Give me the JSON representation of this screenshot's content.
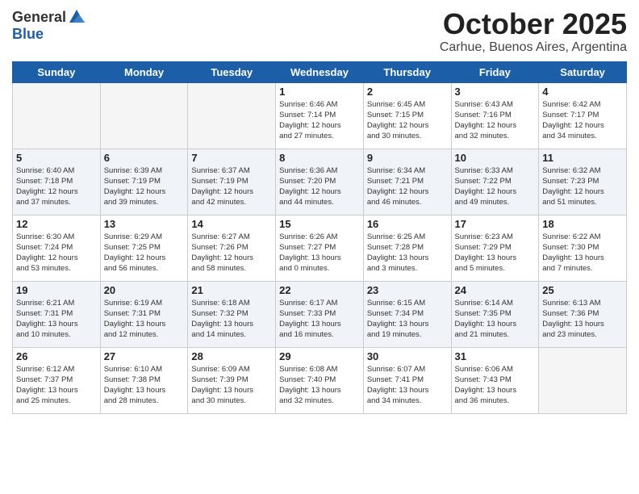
{
  "logo": {
    "general": "General",
    "blue": "Blue"
  },
  "title": "October 2025",
  "location": "Carhue, Buenos Aires, Argentina",
  "weekdays": [
    "Sunday",
    "Monday",
    "Tuesday",
    "Wednesday",
    "Thursday",
    "Friday",
    "Saturday"
  ],
  "weeks": [
    [
      {
        "day": "",
        "info": ""
      },
      {
        "day": "",
        "info": ""
      },
      {
        "day": "",
        "info": ""
      },
      {
        "day": "1",
        "info": "Sunrise: 6:46 AM\nSunset: 7:14 PM\nDaylight: 12 hours\nand 27 minutes."
      },
      {
        "day": "2",
        "info": "Sunrise: 6:45 AM\nSunset: 7:15 PM\nDaylight: 12 hours\nand 30 minutes."
      },
      {
        "day": "3",
        "info": "Sunrise: 6:43 AM\nSunset: 7:16 PM\nDaylight: 12 hours\nand 32 minutes."
      },
      {
        "day": "4",
        "info": "Sunrise: 6:42 AM\nSunset: 7:17 PM\nDaylight: 12 hours\nand 34 minutes."
      }
    ],
    [
      {
        "day": "5",
        "info": "Sunrise: 6:40 AM\nSunset: 7:18 PM\nDaylight: 12 hours\nand 37 minutes."
      },
      {
        "day": "6",
        "info": "Sunrise: 6:39 AM\nSunset: 7:19 PM\nDaylight: 12 hours\nand 39 minutes."
      },
      {
        "day": "7",
        "info": "Sunrise: 6:37 AM\nSunset: 7:19 PM\nDaylight: 12 hours\nand 42 minutes."
      },
      {
        "day": "8",
        "info": "Sunrise: 6:36 AM\nSunset: 7:20 PM\nDaylight: 12 hours\nand 44 minutes."
      },
      {
        "day": "9",
        "info": "Sunrise: 6:34 AM\nSunset: 7:21 PM\nDaylight: 12 hours\nand 46 minutes."
      },
      {
        "day": "10",
        "info": "Sunrise: 6:33 AM\nSunset: 7:22 PM\nDaylight: 12 hours\nand 49 minutes."
      },
      {
        "day": "11",
        "info": "Sunrise: 6:32 AM\nSunset: 7:23 PM\nDaylight: 12 hours\nand 51 minutes."
      }
    ],
    [
      {
        "day": "12",
        "info": "Sunrise: 6:30 AM\nSunset: 7:24 PM\nDaylight: 12 hours\nand 53 minutes."
      },
      {
        "day": "13",
        "info": "Sunrise: 6:29 AM\nSunset: 7:25 PM\nDaylight: 12 hours\nand 56 minutes."
      },
      {
        "day": "14",
        "info": "Sunrise: 6:27 AM\nSunset: 7:26 PM\nDaylight: 12 hours\nand 58 minutes."
      },
      {
        "day": "15",
        "info": "Sunrise: 6:26 AM\nSunset: 7:27 PM\nDaylight: 13 hours\nand 0 minutes."
      },
      {
        "day": "16",
        "info": "Sunrise: 6:25 AM\nSunset: 7:28 PM\nDaylight: 13 hours\nand 3 minutes."
      },
      {
        "day": "17",
        "info": "Sunrise: 6:23 AM\nSunset: 7:29 PM\nDaylight: 13 hours\nand 5 minutes."
      },
      {
        "day": "18",
        "info": "Sunrise: 6:22 AM\nSunset: 7:30 PM\nDaylight: 13 hours\nand 7 minutes."
      }
    ],
    [
      {
        "day": "19",
        "info": "Sunrise: 6:21 AM\nSunset: 7:31 PM\nDaylight: 13 hours\nand 10 minutes."
      },
      {
        "day": "20",
        "info": "Sunrise: 6:19 AM\nSunset: 7:31 PM\nDaylight: 13 hours\nand 12 minutes."
      },
      {
        "day": "21",
        "info": "Sunrise: 6:18 AM\nSunset: 7:32 PM\nDaylight: 13 hours\nand 14 minutes."
      },
      {
        "day": "22",
        "info": "Sunrise: 6:17 AM\nSunset: 7:33 PM\nDaylight: 13 hours\nand 16 minutes."
      },
      {
        "day": "23",
        "info": "Sunrise: 6:15 AM\nSunset: 7:34 PM\nDaylight: 13 hours\nand 19 minutes."
      },
      {
        "day": "24",
        "info": "Sunrise: 6:14 AM\nSunset: 7:35 PM\nDaylight: 13 hours\nand 21 minutes."
      },
      {
        "day": "25",
        "info": "Sunrise: 6:13 AM\nSunset: 7:36 PM\nDaylight: 13 hours\nand 23 minutes."
      }
    ],
    [
      {
        "day": "26",
        "info": "Sunrise: 6:12 AM\nSunset: 7:37 PM\nDaylight: 13 hours\nand 25 minutes."
      },
      {
        "day": "27",
        "info": "Sunrise: 6:10 AM\nSunset: 7:38 PM\nDaylight: 13 hours\nand 28 minutes."
      },
      {
        "day": "28",
        "info": "Sunrise: 6:09 AM\nSunset: 7:39 PM\nDaylight: 13 hours\nand 30 minutes."
      },
      {
        "day": "29",
        "info": "Sunrise: 6:08 AM\nSunset: 7:40 PM\nDaylight: 13 hours\nand 32 minutes."
      },
      {
        "day": "30",
        "info": "Sunrise: 6:07 AM\nSunset: 7:41 PM\nDaylight: 13 hours\nand 34 minutes."
      },
      {
        "day": "31",
        "info": "Sunrise: 6:06 AM\nSunset: 7:43 PM\nDaylight: 13 hours\nand 36 minutes."
      },
      {
        "day": "",
        "info": ""
      }
    ]
  ]
}
